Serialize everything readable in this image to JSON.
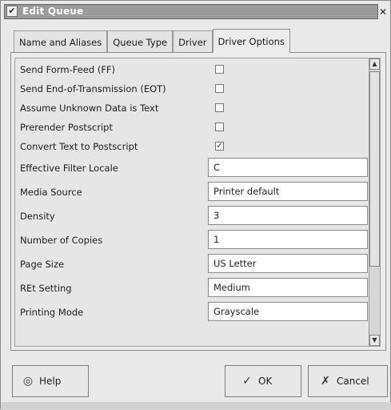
{
  "window": {
    "title": "Edit Queue",
    "menu_glyph": "✔",
    "close_glyph": "✕"
  },
  "tabs": [
    {
      "label": "Name and Aliases",
      "active": false
    },
    {
      "label": "Queue Type",
      "active": false
    },
    {
      "label": "Driver",
      "active": false
    },
    {
      "label": "Driver Options",
      "active": true
    }
  ],
  "options": [
    {
      "label": "Send Form-Feed (FF)",
      "type": "checkbox",
      "checked": false
    },
    {
      "label": "Send End-of-Transmission (EOT)",
      "type": "checkbox",
      "checked": false
    },
    {
      "label": "Assume Unknown Data is Text",
      "type": "checkbox",
      "checked": false
    },
    {
      "label": "Prerender Postscript",
      "type": "checkbox",
      "checked": false
    },
    {
      "label": "Convert Text to Postscript",
      "type": "checkbox",
      "checked": true
    },
    {
      "label": "Effective Filter Locale",
      "type": "dropdown",
      "value": "C"
    },
    {
      "label": "Media Source",
      "type": "dropdown",
      "value": "Printer default"
    },
    {
      "label": "Density",
      "type": "dropdown",
      "value": "3"
    },
    {
      "label": "Number of Copies",
      "type": "spinner",
      "value": "1"
    },
    {
      "label": "Page Size",
      "type": "dropdown",
      "value": "US Letter"
    },
    {
      "label": "REt Setting",
      "type": "dropdown",
      "value": "Medium"
    },
    {
      "label": "Printing Mode",
      "type": "dropdown",
      "value": "Grayscale"
    }
  ],
  "buttons": {
    "help_label": "Help",
    "ok_label": "OK",
    "cancel_label": "Cancel"
  },
  "icons": {
    "checkmark": "✓",
    "dropdown_arrow": "▾",
    "scroll_up": "▲",
    "scroll_down": "▼"
  }
}
